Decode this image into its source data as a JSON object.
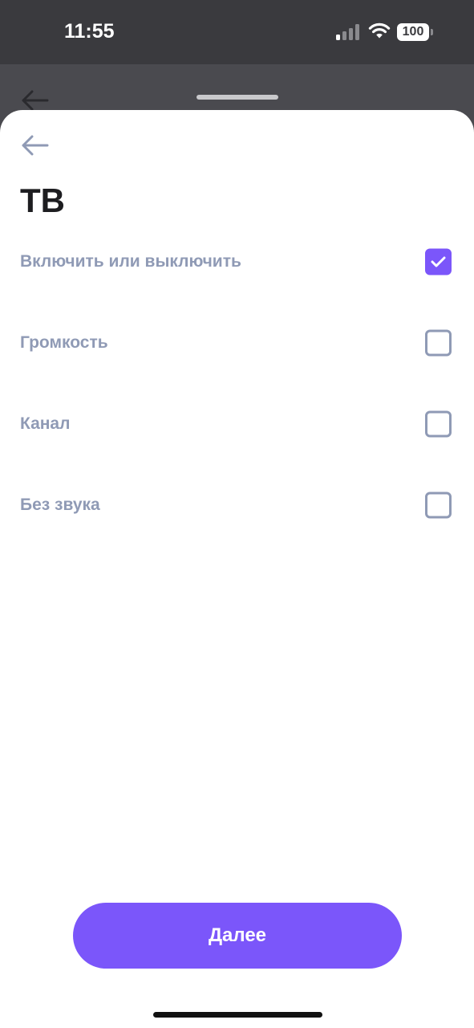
{
  "status_bar": {
    "time": "11:55",
    "battery": "100"
  },
  "header": {
    "title": "ТВ"
  },
  "options": [
    {
      "label": "Включить или выключить",
      "checked": true
    },
    {
      "label": "Громкость",
      "checked": false
    },
    {
      "label": "Канал",
      "checked": false
    },
    {
      "label": "Без звука",
      "checked": false
    }
  ],
  "footer": {
    "next_label": "Далее"
  },
  "colors": {
    "accent": "#7b56fa",
    "label": "#8f9ab5",
    "title": "#1d1d20"
  },
  "icons": {
    "back": "arrow-left-icon",
    "check": "checkmark-icon",
    "signal": "cellular-signal-icon",
    "wifi": "wifi-icon",
    "battery": "battery-icon"
  }
}
